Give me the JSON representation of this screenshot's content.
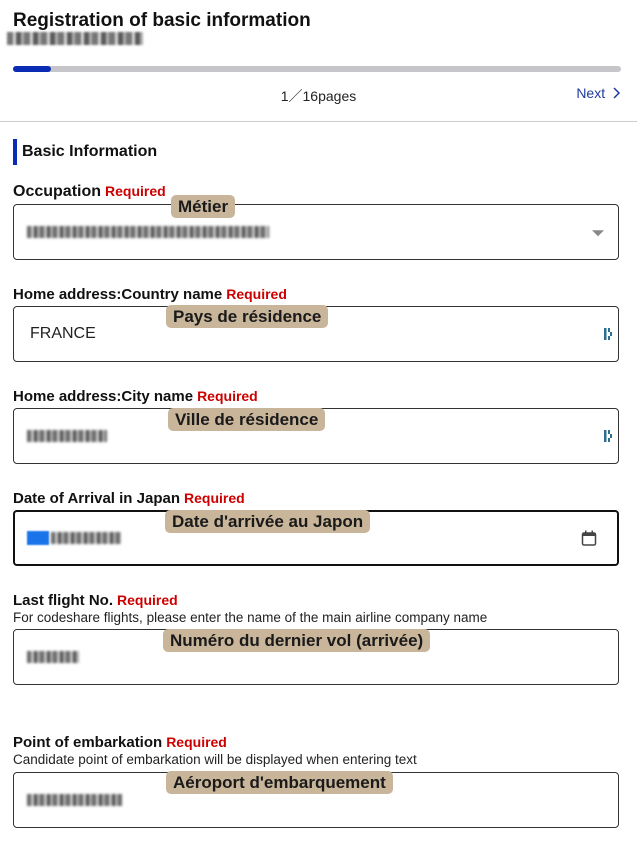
{
  "header": {
    "title": "Registration of basic information",
    "subtitle_masked": true,
    "progress": {
      "current_page": 1,
      "total_pages": 16,
      "fraction": 0.0625
    },
    "pages_label": "1／16pages",
    "next_label": "Next"
  },
  "section": {
    "title": "Basic Information"
  },
  "required_label": "Required",
  "fields": {
    "occupation": {
      "label": "Occupation",
      "value_masked": true,
      "type": "select",
      "annotation": "Métier"
    },
    "country": {
      "label": "Home address:Country name",
      "value": "FRANCE",
      "annotation": "Pays de résidence"
    },
    "city": {
      "label": "Home address:City name",
      "value_masked": true,
      "annotation": "Ville de résidence"
    },
    "arrival_date": {
      "label": "Date of Arrival in Japan",
      "value_masked": true,
      "annotation": "Date d'arrivée au Japon"
    },
    "flight": {
      "label": "Last flight No.",
      "hint": "For codeshare flights, please enter the name of the main airline company name",
      "value_masked": true,
      "annotation": "Numéro du dernier vol (arrivée)"
    },
    "embarkation": {
      "label": "Point of embarkation",
      "hint": "Candidate point of embarkation will be displayed when entering text",
      "value_masked": true,
      "annotation": "Aéroport d'embarquement"
    }
  },
  "colors": {
    "accent": "#0a2bb3",
    "required": "#cc0000",
    "annotation_bg": "#c8b59a",
    "link": "#1f3a9e"
  }
}
